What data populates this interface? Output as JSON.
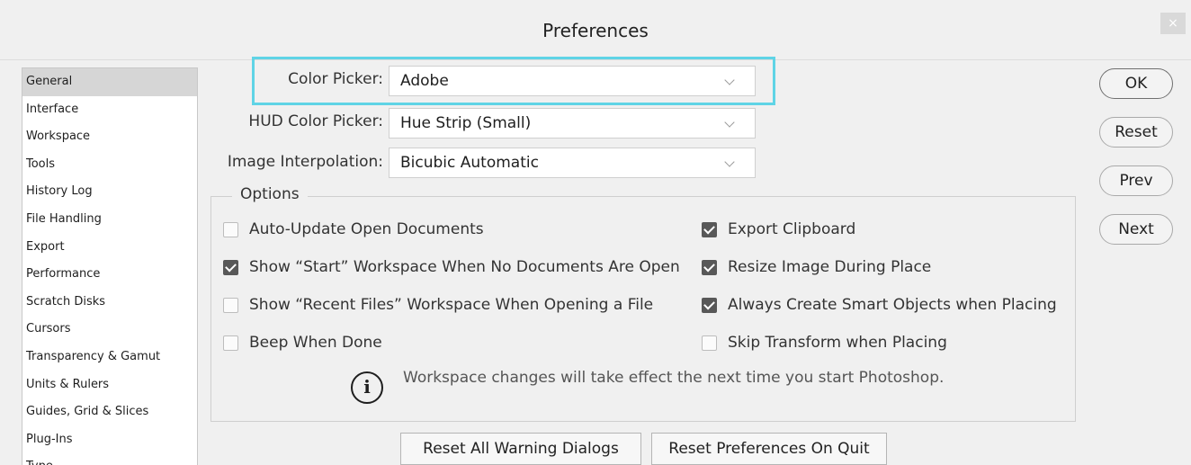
{
  "dialog": {
    "title": "Preferences",
    "close_glyph": "×"
  },
  "sidebar": {
    "items": [
      {
        "label": "General",
        "selected": true
      },
      {
        "label": "Interface"
      },
      {
        "label": "Workspace"
      },
      {
        "label": "Tools"
      },
      {
        "label": "History Log"
      },
      {
        "label": "File Handling"
      },
      {
        "label": "Export"
      },
      {
        "label": "Performance"
      },
      {
        "label": "Scratch Disks"
      },
      {
        "label": "Cursors"
      },
      {
        "label": "Transparency & Gamut"
      },
      {
        "label": "Units & Rulers"
      },
      {
        "label": "Guides, Grid & Slices"
      },
      {
        "label": "Plug-Ins"
      },
      {
        "label": "Type"
      }
    ]
  },
  "form": {
    "color_picker": {
      "label": "Color Picker:",
      "value": "Adobe"
    },
    "hud_color_picker": {
      "label": "HUD Color Picker:",
      "value": "Hue Strip (Small)"
    },
    "image_interpolation": {
      "label": "Image Interpolation:",
      "value": "Bicubic Automatic"
    }
  },
  "options": {
    "legend": "Options",
    "left": [
      {
        "label": "Auto-Update Open Documents",
        "checked": false
      },
      {
        "label": "Show “Start” Workspace When No Documents Are Open",
        "checked": true
      },
      {
        "label": "Show “Recent Files” Workspace When Opening a File",
        "checked": false
      },
      {
        "label": "Beep When Done",
        "checked": false
      }
    ],
    "right": [
      {
        "label": "Export Clipboard",
        "checked": true
      },
      {
        "label": "Resize Image During Place",
        "checked": true
      },
      {
        "label": "Always Create Smart Objects when Placing",
        "checked": true
      },
      {
        "label": "Skip Transform when Placing",
        "checked": false
      }
    ],
    "info_glyph": "i",
    "info_text": "Workspace changes will take effect the next time you start Photoshop."
  },
  "buttons": {
    "ok": "OK",
    "reset": "Reset",
    "prev": "Prev",
    "next": "Next",
    "reset_warnings": "Reset All Warning Dialogs",
    "reset_on_quit": "Reset Preferences On Quit"
  },
  "colors": {
    "highlight": "#5fd4e6",
    "background": "#f0f0f0",
    "selected_item": "#d6d6d6",
    "checkbox_checked": "#585858"
  }
}
